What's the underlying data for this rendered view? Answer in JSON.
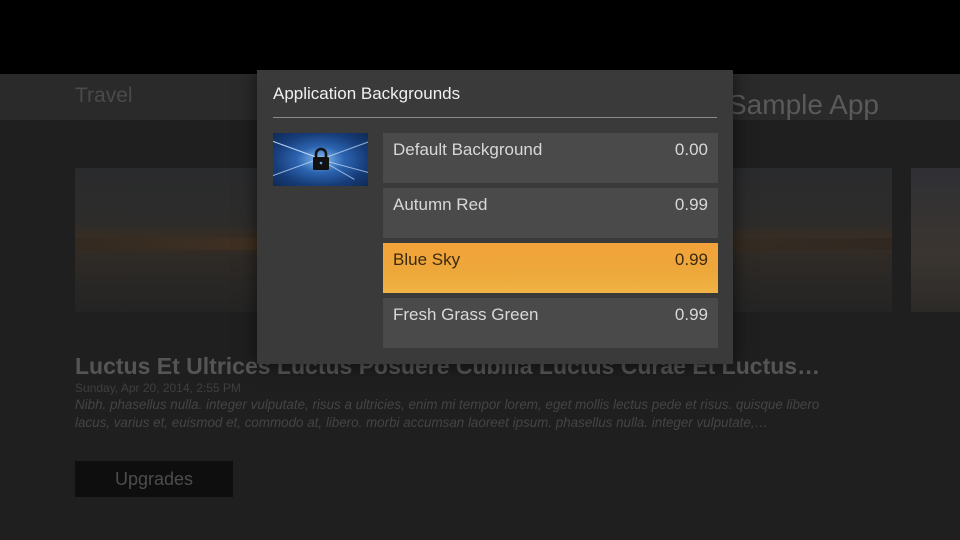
{
  "background_app": {
    "nav_label": "Travel",
    "app_title": "Sample App",
    "article": {
      "title": "Luctus Et Ultrices Luctus Posuere Cubilia Luctus Curae Et Luctus…",
      "date": "Sunday, Apr 20, 2014, 2:55 PM",
      "body": "Nibh. phasellus nulla. integer vulputate, risus a ultricies, enim mi tempor lorem, eget mollis lectus pede et risus. quisque libero lacus, varius et, euismod et, commodo at, libero. morbi accumsan laoreet ipsum. phasellus nulla. integer vulputate,…"
    },
    "upgrades_label": "Upgrades"
  },
  "dialog": {
    "title": "Application Backgrounds",
    "preview_icon": "lock-icon",
    "options": [
      {
        "name": "Default Background",
        "price": "0.00",
        "selected": false
      },
      {
        "name": "Autumn Red",
        "price": "0.99",
        "selected": false
      },
      {
        "name": "Blue Sky",
        "price": "0.99",
        "selected": true
      },
      {
        "name": "Fresh Grass Green",
        "price": "0.99",
        "selected": false
      }
    ]
  },
  "colors": {
    "accent": "#f0a835",
    "dialog_bg": "#3a3a3a",
    "option_bg": "#4a4a4a"
  }
}
